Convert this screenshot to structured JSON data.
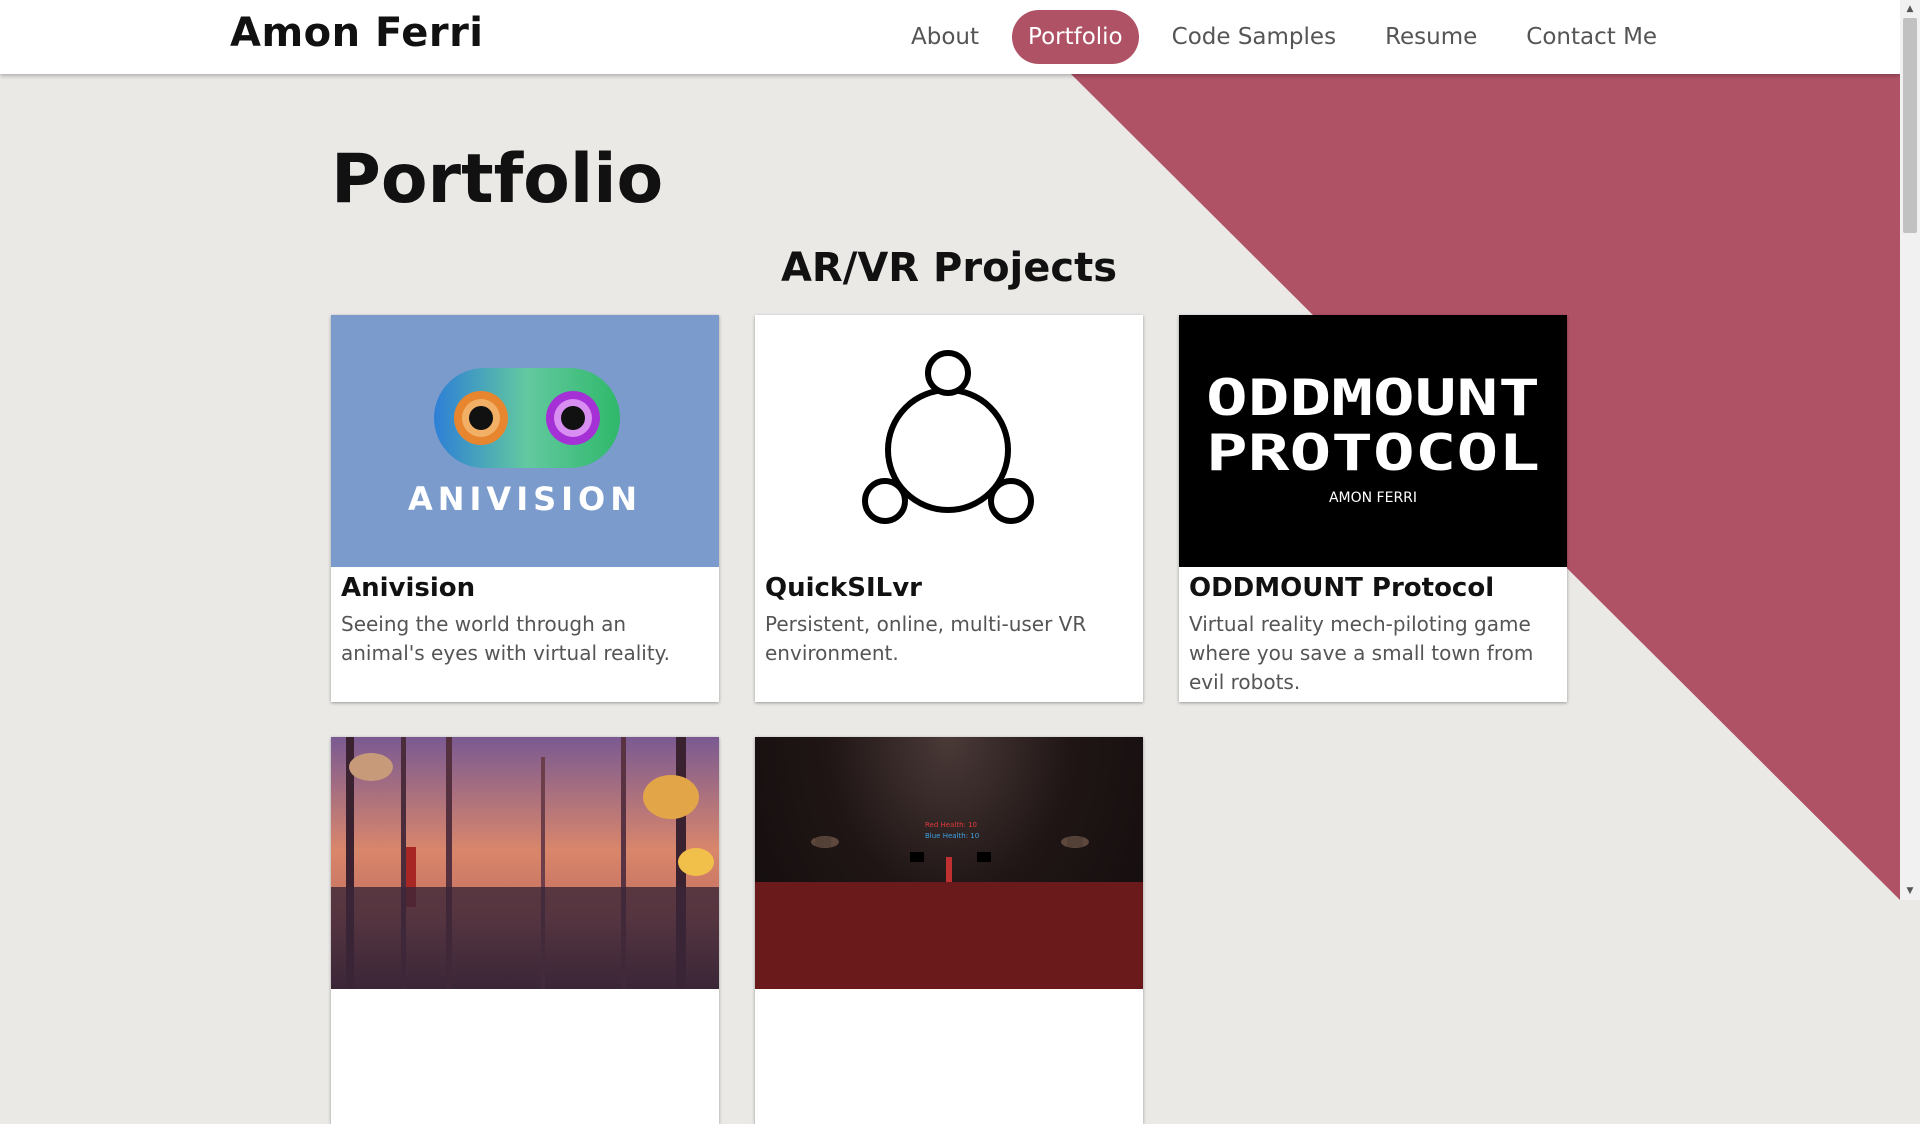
{
  "header": {
    "brand": "Amon Ferri",
    "nav": [
      "About",
      "Portfolio",
      "Code Samples",
      "Resume",
      "Contact Me"
    ],
    "active_nav": "Portfolio"
  },
  "main": {
    "title": "Portfolio",
    "section_title": "AR/VR Projects",
    "cards": [
      {
        "title": "Anivision",
        "description": "Seeing the world through an animal's eyes with virtual reality.",
        "image_text": "ANIVISION"
      },
      {
        "title": "QuickSILvr",
        "description": "Persistent, online, multi-user VR environment."
      },
      {
        "title": "ODDMOUNT Protocol",
        "description": "Virtual reality mech-piloting game where you save a small town from evil robots.",
        "image_text": [
          "ODDMOUNT",
          "PROTOCOL"
        ],
        "image_subtext": "AMON FERRI"
      },
      {
        "title": "",
        "description": ""
      },
      {
        "title": "",
        "description": "",
        "image_text": [
          "Red Health: 10",
          "Blue Health: 10"
        ]
      }
    ]
  },
  "colors": {
    "accent": "#b05266",
    "background": "#ebe9e6",
    "anivision_bg": "#7a9bcc"
  }
}
